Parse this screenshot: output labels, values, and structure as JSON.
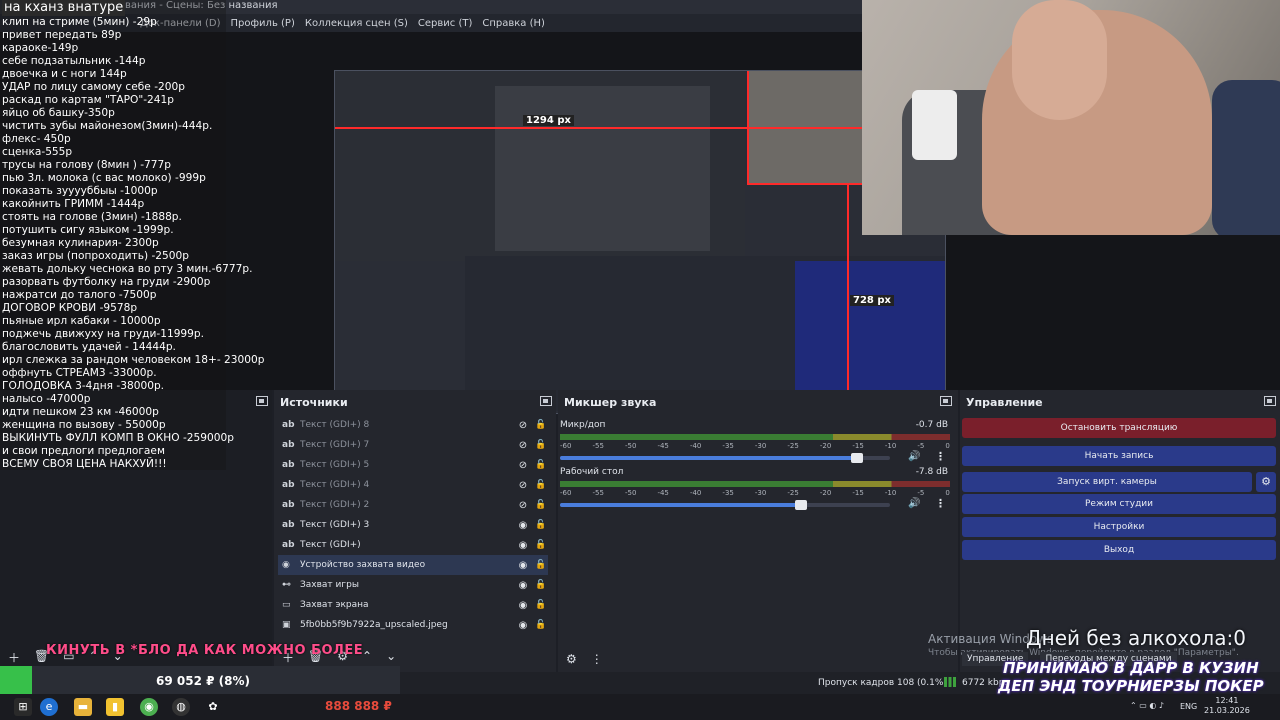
{
  "window": {
    "title": "вания - Сцены: Без названия"
  },
  "menu": [
    "Док-панели (D)",
    "Профиль (P)",
    "Коллекция сцен (S)",
    "Сервис (T)",
    "Справка (H)"
  ],
  "pricelist": {
    "heading": "на кханз внатуре",
    "lines": [
      "клип на стриме (5мин) -29р",
      "привет передать 89р",
      "караоке-149р",
      "себе подзатыльник -144р",
      "двоечка и с ноги 144р",
      "УДАР по лицу самому себе -200р",
      "раскад по картам \"ТАРО\"-241р",
      "яйцо об башку-350р",
      "чистить зубы майонезом(3мин)-444р.",
      "флекс- 450р",
      "сценка-555р",
      "трусы на голову (8мин ) -777р",
      "пью 3л. молока (с вас молоко) -999р",
      "показать зууууббыы -1000р",
      "какойнить ГРИММ -1444р",
      "стоять на голове (3мин) -1888р.",
      "потушить сигу языком -1999р.",
      "безумная кулинария- 2300р",
      "заказ игры (попроходить) -2500р",
      "жевать дольку чеснока во рту 3 мин.-6777р.",
      "разорвать футболку на груди -2900р",
      "нажратси до талого -7500р",
      "ДОГОВОР КРОВИ -9578р",
      "пьяные ирл кабаки - 10000р",
      "поджечь движуху на груди-11999р.",
      "благословить удачей - 14444р.",
      "ирл слежка за рандом человеком 18+- 23000р",
      "оффнуть СТРЕАМ3 -33000р.",
      "ГОЛОДОВКА 3-4дня -38000р.",
      "налысо -47000р",
      "идти пешком 23 км -46000р",
      "женщина по вызову - 55000р",
      "ВЫКИНУТЬ ФУЛЛ КОМП В ОКНО -259000р",
      "и свои предлоги предлогаем",
      "ВСЕМУ СВОЯ ЦЕНА НАКХУЙ!!!"
    ]
  },
  "preview": {
    "dim_label_1": "1294 px",
    "dim_label_2": "728 px"
  },
  "docks": {
    "sources_title": "Источники",
    "mixer_title": "Микшер звука",
    "controls_title": "Управление"
  },
  "sources": [
    {
      "name": "Текст (GDI+) 8",
      "type": "ab",
      "visible": false
    },
    {
      "name": "Текст (GDI+) 7",
      "type": "ab",
      "visible": false
    },
    {
      "name": "Текст (GDI+) 5",
      "type": "ab",
      "visible": false
    },
    {
      "name": "Текст (GDI+) 4",
      "type": "ab",
      "visible": false
    },
    {
      "name": "Текст (GDI+) 2",
      "type": "ab",
      "visible": false
    },
    {
      "name": "Текст (GDI+) 3",
      "type": "ab",
      "visible": true
    },
    {
      "name": "Текст (GDI+)",
      "type": "ab",
      "visible": true
    },
    {
      "name": "Устройство захвата видео",
      "type": "cam",
      "visible": true,
      "selected": true
    },
    {
      "name": "Захват игры",
      "type": "game",
      "visible": true
    },
    {
      "name": "Захват экрана",
      "type": "screen",
      "visible": true
    },
    {
      "name": "5fb0bb5f9b7922a_upscaled.jpeg",
      "type": "img",
      "visible": true
    }
  ],
  "mixer": {
    "tracks": [
      {
        "name": "Микр/доп",
        "db": "-0.7 dB",
        "level": 0.9
      },
      {
        "name": "Рабочий стол",
        "db": "-7.8 dB",
        "level": 0.73
      }
    ],
    "ticks": [
      "-60",
      "-55",
      "-50",
      "-45",
      "-40",
      "-35",
      "-30",
      "-25",
      "-20",
      "-15",
      "-10",
      "-5",
      "0"
    ]
  },
  "controls": {
    "stop_stream": "Остановить трансляцию",
    "start_record": "Начать запись",
    "virtual_cam": "Запуск вирт. камеры",
    "studio_mode": "Режим студии",
    "settings": "Настройки",
    "exit": "Выход"
  },
  "bottom_tabs": [
    "Управление",
    "Переходы между сценами"
  ],
  "status": {
    "dropped": "Пропуск кадров 108 (0.1%)",
    "kbps": "6772 kbps"
  },
  "donation": {
    "amount": "69 052 ₽ (8%)",
    "progress": 0.08,
    "total": "888 888 ₽"
  },
  "overlays": {
    "kick": "КИНУТЬ В *БЛО ДА КАК МОЖНО БОЛЕЕ",
    "sober_days": "Дней без алкохола:0",
    "promo_line1": "ПРИНИМАЮ В ДАРР В КУЗИН",
    "promo_line2": "ДЕП ЭНД ТОУРНИЕРЗЫ ПОКЕР",
    "win_activate": "Активация Windows",
    "win_activate_sub": "Чтобы активировать Windows, перейдите в раздел \"Параметры\"."
  },
  "taskbar": {
    "lang": "ENG",
    "time": "12:41",
    "date": "21.03.2026"
  }
}
